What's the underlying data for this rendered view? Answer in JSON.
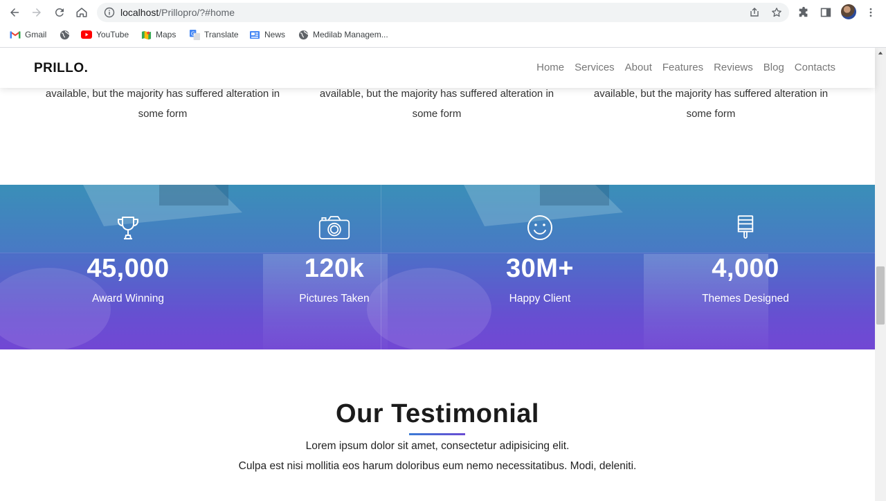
{
  "browser": {
    "url_host": "localhost",
    "url_path": "/Prillopro/?#home",
    "bookmarks": [
      {
        "label": "Gmail",
        "icon": "gmail-icon"
      },
      {
        "label": "",
        "icon": "globe-icon"
      },
      {
        "label": "YouTube",
        "icon": "youtube-icon"
      },
      {
        "label": "Maps",
        "icon": "maps-icon"
      },
      {
        "label": "Translate",
        "icon": "translate-icon"
      },
      {
        "label": "News",
        "icon": "news-icon"
      },
      {
        "label": "Medilab Managem...",
        "icon": "globe-icon"
      }
    ]
  },
  "site": {
    "brand": "PRILLO.",
    "nav": [
      "Home",
      "Services",
      "About",
      "Features",
      "Reviews",
      "Blog",
      "Contacts"
    ]
  },
  "services": [
    {
      "line1": "available, but the majority has suffered alteration in",
      "line2": "some form"
    },
    {
      "line1": "available, but the majority has suffered alteration in",
      "line2": "some form"
    },
    {
      "line1": "available, but the majority has suffered alteration in",
      "line2": "some form"
    }
  ],
  "stats": [
    {
      "icon": "trophy-icon",
      "value": "45,000",
      "label": "Award Winning"
    },
    {
      "icon": "camera-icon",
      "value": "120k",
      "label": "Pictures Taken"
    },
    {
      "icon": "smile-icon",
      "value": "30M+",
      "label": "Happy Client"
    },
    {
      "icon": "paint-brush-icon",
      "value": "4,000",
      "label": "Themes Designed"
    }
  ],
  "testimonial": {
    "title": "Our Testimonial",
    "line1": "Lorem ipsum dolor sit amet, consectetur adipisicing elit.",
    "line2": "Culpa est nisi mollitia eos harum doloribus eum nemo necessitatibus. Modi, deleniti."
  },
  "colors": {
    "stats_gradient_top": "#3a8fb8",
    "stats_gradient_bottom": "#7a45d6",
    "accent_line": "#3a7bd5"
  }
}
